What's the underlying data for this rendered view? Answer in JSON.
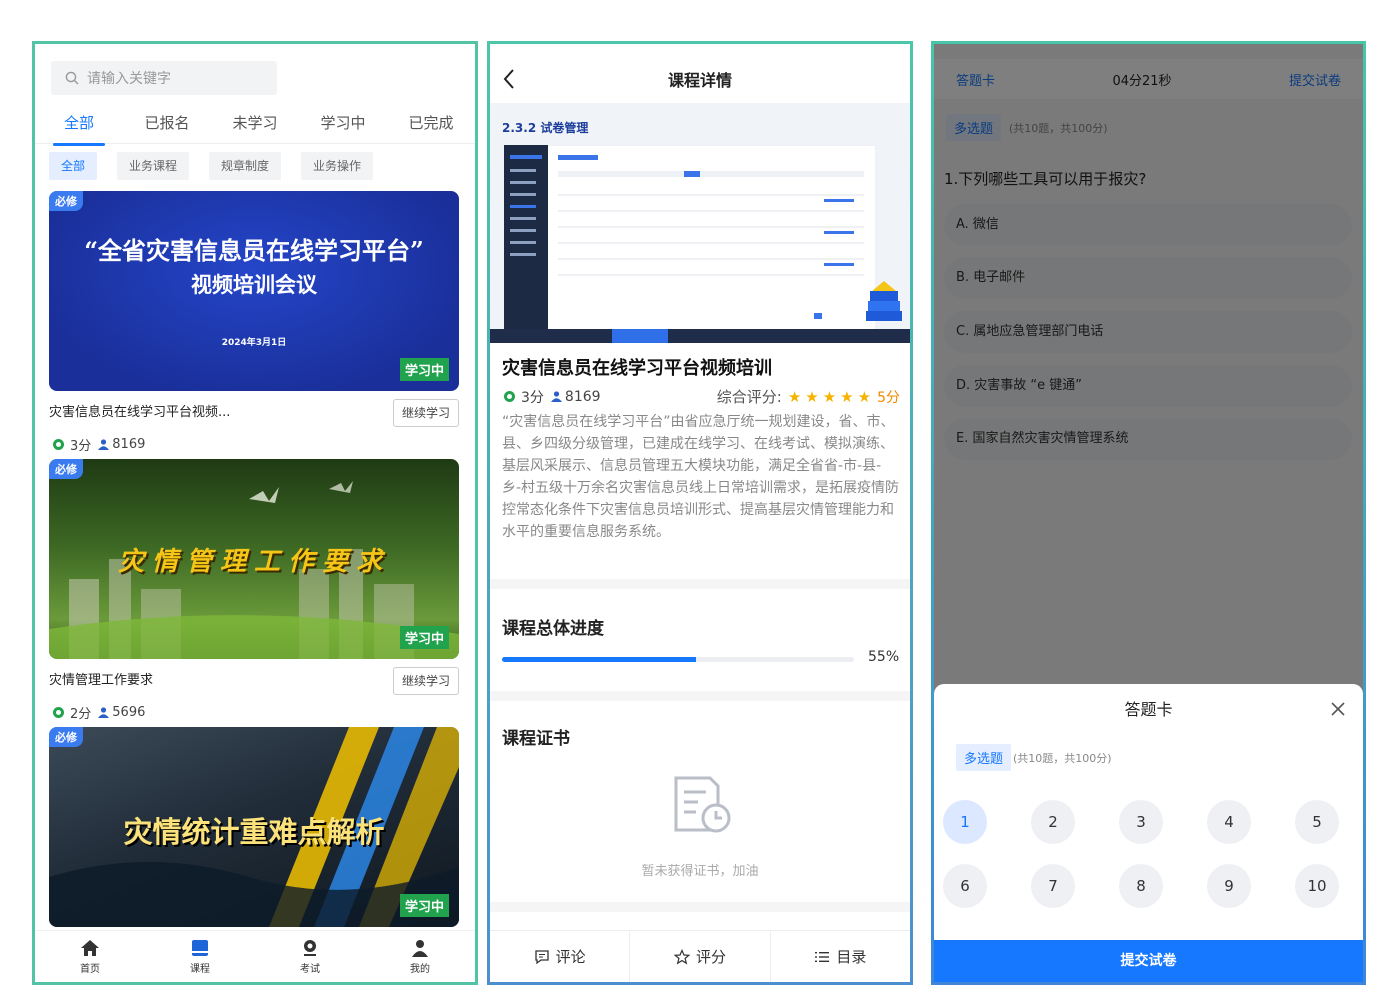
{
  "list_screen": {
    "search_placeholder": "请输入关键字",
    "tabs": [
      "全部",
      "已报名",
      "未学习",
      "学习中",
      "已完成"
    ],
    "categories": [
      "全部",
      "业务课程",
      "规章制度",
      "业务操作"
    ],
    "courses": [
      {
        "badge": "必修",
        "status": "学习中",
        "banner_title_line1": "“全省灾害信息员在线学习平台”",
        "banner_title_line2": "视频培训会议",
        "banner_date": "2024年3月1日",
        "title": "灾害信息员在线学习平台视频...",
        "button": "继续学习",
        "score": "3分",
        "learners": "8169"
      },
      {
        "badge": "必修",
        "status": "学习中",
        "banner_title_line1": "灾情管理工作要求",
        "title": "灾情管理工作要求",
        "button": "继续学习",
        "score": "2分",
        "learners": "5696"
      },
      {
        "badge": "必修",
        "status": "学习中",
        "banner_title_line1": "灾情统计重难点解析"
      }
    ],
    "bottom_nav": [
      "首页",
      "课程",
      "考试",
      "我的"
    ]
  },
  "detail_screen": {
    "header_title": "课程详情",
    "hero_caption": "2.3.2 试卷管理",
    "title": "灾害信息员在线学习平台视频培训",
    "score": "3分",
    "learners": "8169",
    "rating_label": "综合评分:",
    "rating_value": "5分",
    "rating_stars": 5,
    "description": "“灾害信息员在线学习平台”由省应急厅统一规划建设，省、市、县、乡四级分级管理，已建成在线学习、在线考试、模拟演练、基层风采展示、信息员管理五大模块功能，满足全省省-市-县-乡-村五级十万余名灾害信息员线上日常培训需求，是拓展疫情防控常态化条件下灾害信息员培训形式、提高基层灾情管理能力和水平的重要信息服务系统。",
    "progress_title": "课程总体进度",
    "progress_fraction": 0.55,
    "progress_label": "55%",
    "certificate_title": "课程证书",
    "certificate_empty": "暂未获得证书，加油",
    "bottom_actions": [
      "评论",
      "评分",
      "目录"
    ]
  },
  "exam_screen": {
    "header_left": "答题卡",
    "timer": "04分21秒",
    "header_right": "提交试卷",
    "question_type": "多选题",
    "question_meta": "(共10题，共100分)",
    "question": "1.下列哪些工具可以用于报灾?",
    "options": [
      "A. 微信",
      "B. 电子邮件",
      "C. 属地应急管理部门电话",
      "D. 灾害事故 “e 键通”",
      "E. 国家自然灾害灾情管理系统"
    ],
    "sheet_title": "答题卡",
    "sheet_type": "多选题",
    "sheet_meta": "(共10题，共100分)",
    "numbers": [
      "1",
      "2",
      "3",
      "4",
      "5",
      "6",
      "7",
      "8",
      "9",
      "10"
    ],
    "submit_label": "提交试卷"
  }
}
